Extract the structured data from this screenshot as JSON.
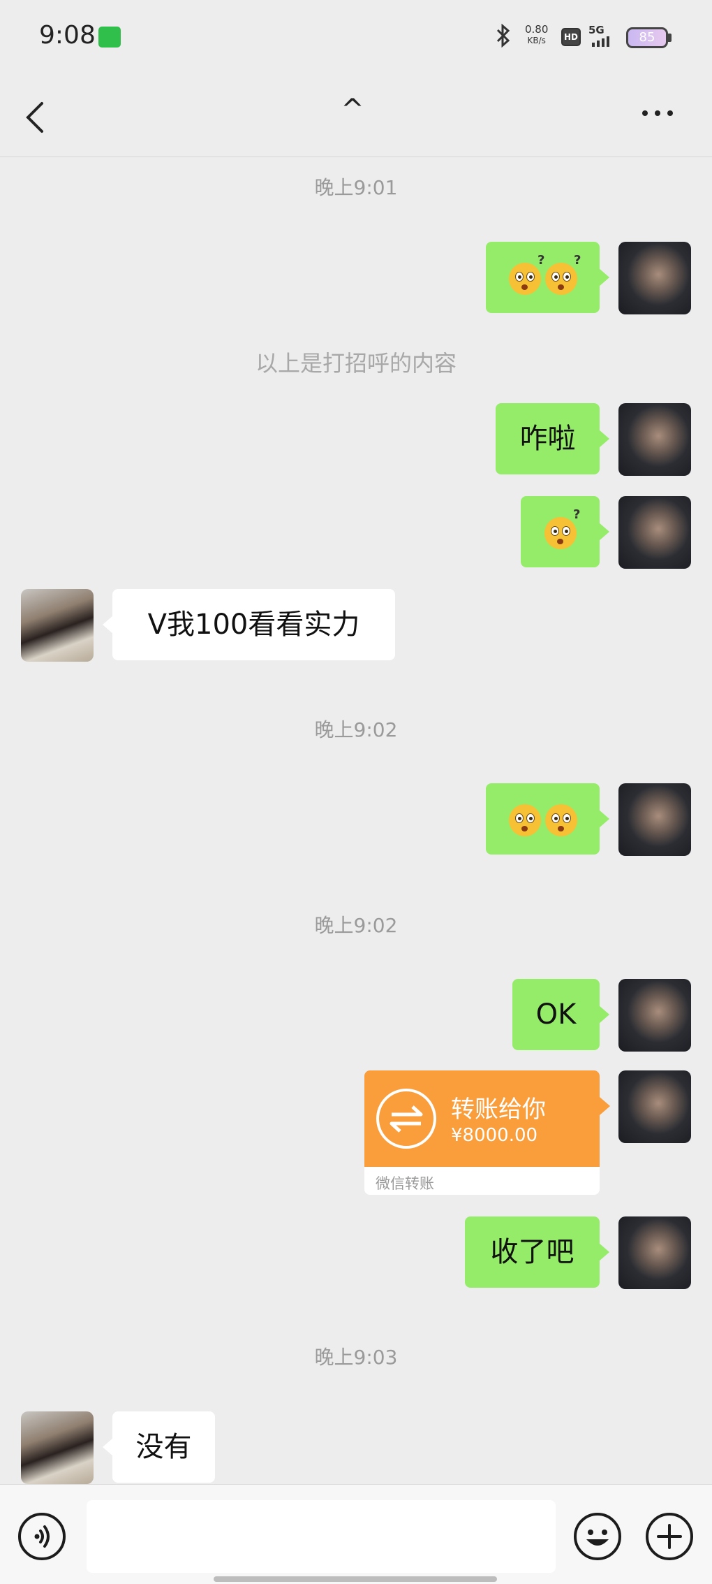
{
  "status_bar": {
    "time": "9:08",
    "net_speed_value": "0.80",
    "net_speed_unit": "KB/s",
    "hd_label": "HD",
    "network_label": "5G",
    "battery_level": "85",
    "icons": [
      "app-notification-icon",
      "bluetooth-icon",
      "signal-icon",
      "battery-icon"
    ]
  },
  "navbar": {
    "title": "^",
    "icons": [
      "back-arrow-icon",
      "more-dots-icon"
    ]
  },
  "messages": [
    {
      "kind": "timestamp",
      "text": "晚上9:01"
    },
    {
      "kind": "sent",
      "content": "emoji",
      "emoji": [
        "confused-emoji",
        "confused-emoji"
      ]
    },
    {
      "kind": "system",
      "text": "以上是打招呼的内容"
    },
    {
      "kind": "sent",
      "text": "咋啦"
    },
    {
      "kind": "sent",
      "content": "emoji",
      "emoji": [
        "confused-emoji"
      ]
    },
    {
      "kind": "received",
      "text": "V我100看看实力"
    },
    {
      "kind": "timestamp",
      "text": "晚上9:02"
    },
    {
      "kind": "sent",
      "content": "emoji",
      "emoji": [
        "staring-emoji",
        "staring-emoji"
      ]
    },
    {
      "kind": "timestamp",
      "text": "晚上9:02"
    },
    {
      "kind": "sent",
      "text": "OK"
    },
    {
      "kind": "sent",
      "content": "transfer",
      "transfer": {
        "title": "转账给你",
        "amount": "¥8000.00",
        "footer": "微信转账"
      }
    },
    {
      "kind": "sent",
      "text": "收了吧"
    },
    {
      "kind": "timestamp",
      "text": "晚上9:03"
    },
    {
      "kind": "received",
      "text": "没有"
    }
  ],
  "input_bar": {
    "value": "",
    "icons": [
      "voice-icon",
      "emoji-face-icon",
      "plus-icon"
    ]
  },
  "colors": {
    "background": "#ededed",
    "sent_bubble": "#95ec69",
    "received_bubble": "#ffffff",
    "transfer_card": "#fa9d3b",
    "timestamp_text": "#9a9a9a"
  }
}
